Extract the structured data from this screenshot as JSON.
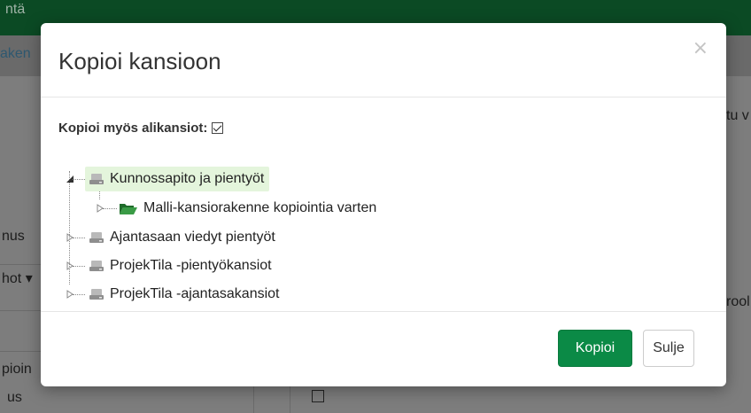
{
  "background": {
    "topbar_text": "ntä",
    "tab_text": "aken",
    "left_texts": [
      "nus",
      "hot ▾",
      "pioin",
      "us"
    ],
    "right_texts": [
      "tu v",
      "rool"
    ]
  },
  "modal": {
    "title": "Kopioi kansioon",
    "close_label": "×",
    "copy_subfolders_label": "Kopioi myös alikansiot:",
    "copy_subfolders_checked": true,
    "tree": [
      {
        "label": "Kunnossapito ja pientyöt",
        "icon": "drive-icon",
        "expanded": true,
        "selected": true,
        "children": [
          {
            "label": "Malli-kansiorakenne kopiointia varten",
            "icon": "folder-open-icon"
          }
        ]
      },
      {
        "label": "Ajantasaan viedyt pientyöt",
        "icon": "drive-icon"
      },
      {
        "label": "ProjekTila -pientyökansiot",
        "icon": "drive-icon"
      },
      {
        "label": "ProjekTila -ajantasakansiot",
        "icon": "drive-icon"
      }
    ],
    "buttons": {
      "primary": "Kopioi",
      "secondary": "Sulje"
    }
  },
  "colors": {
    "primary_button": "#0b8a46",
    "selected_row": "#e4f5dc",
    "folder_green": "#2f8a3a"
  }
}
